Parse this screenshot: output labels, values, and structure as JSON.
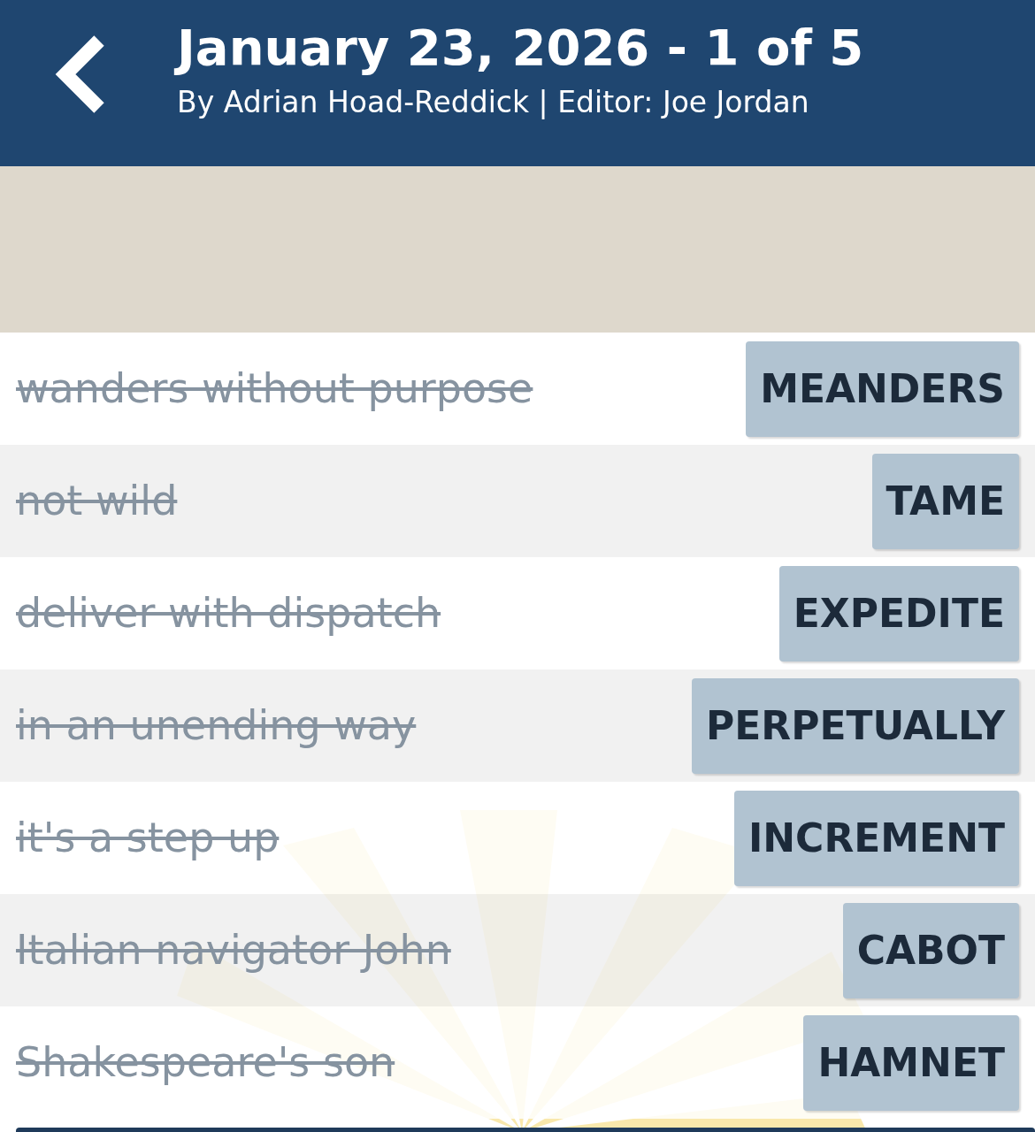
{
  "header": {
    "title": "January 23, 2026 - 1 of 5",
    "byline": "By Adrian Hoad-Reddick | Editor: Joe Jordan"
  },
  "clues": [
    {
      "clue": "wanders without purpose",
      "answer": "MEANDERS",
      "solved": true
    },
    {
      "clue": "not wild",
      "answer": "TAME",
      "solved": true
    },
    {
      "clue": "deliver with dispatch",
      "answer": "EXPEDITE",
      "solved": true
    },
    {
      "clue": "in an unending way",
      "answer": "PERPETUALLY",
      "solved": true
    },
    {
      "clue": "it's a step up",
      "answer": "INCREMENT",
      "solved": true
    },
    {
      "clue": "Italian navigator John",
      "answer": "CABOT",
      "solved": true
    },
    {
      "clue": "Shakespeare's son",
      "answer": "HAMNET",
      "solved": true
    }
  ]
}
